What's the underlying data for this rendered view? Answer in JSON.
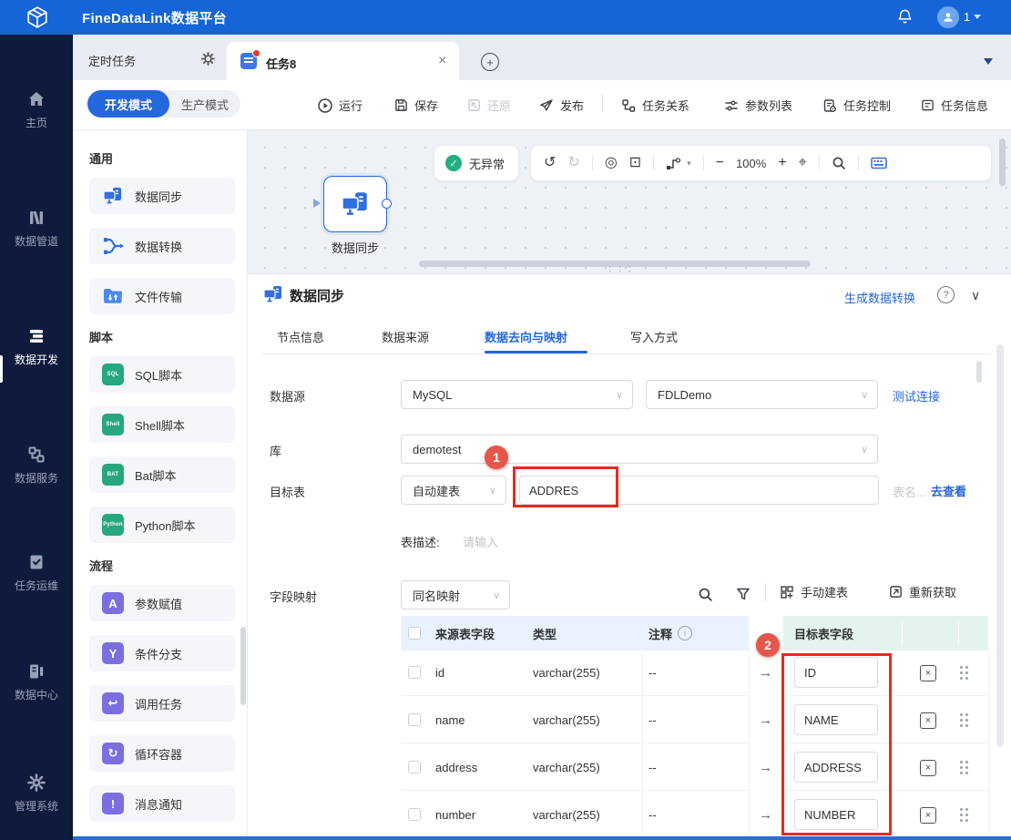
{
  "topbar": {
    "title": "FineDataLink数据平台",
    "user_badge": "1"
  },
  "tabstrip": {
    "panel_label": "定时任务",
    "tab_label": "任务8"
  },
  "toolbar": {
    "mode_dev": "开发模式",
    "mode_prod": "生产模式",
    "run": "运行",
    "save": "保存",
    "restore": "还原",
    "publish": "发布",
    "task_rel": "任务关系",
    "param_list": "参数列表",
    "task_ctrl": "任务控制",
    "task_info": "任务信息"
  },
  "sidebar": {
    "items": [
      {
        "label": "主页"
      },
      {
        "label": "数据管道"
      },
      {
        "label": "数据开发"
      },
      {
        "label": "数据服务"
      },
      {
        "label": "任务运维"
      },
      {
        "label": "数据中心"
      },
      {
        "label": "管理系统"
      }
    ],
    "active_index": 2
  },
  "palette": {
    "sec_general": "通用",
    "sec_script": "脚本",
    "sec_flow": "流程",
    "general": [
      {
        "label": "数据同步"
      },
      {
        "label": "数据转换"
      },
      {
        "label": "文件传输"
      }
    ],
    "script": [
      {
        "label": "SQL脚本",
        "icon_text": "SQL"
      },
      {
        "label": "Shell脚本",
        "icon_text": "Shell"
      },
      {
        "label": "Bat脚本",
        "icon_text": "BAT"
      },
      {
        "label": "Python脚本",
        "icon_text": "Python"
      }
    ],
    "flow": [
      {
        "label": "参数赋值",
        "glyph": "A"
      },
      {
        "label": "条件分支",
        "glyph": "Y"
      },
      {
        "label": "调用任务",
        "glyph": "↩"
      },
      {
        "label": "循环容器",
        "glyph": "↻"
      },
      {
        "label": "消息通知",
        "glyph": "!"
      }
    ]
  },
  "canvas": {
    "node_label": "数据同步",
    "status": "无异常",
    "zoom_level": "100%"
  },
  "panel": {
    "title": "数据同步",
    "gen_link": "生成数据转换",
    "tabs": [
      {
        "label": "节点信息"
      },
      {
        "label": "数据来源"
      },
      {
        "label": "数据去向与映射"
      },
      {
        "label": "写入方式"
      }
    ],
    "active_tab": 2
  },
  "form": {
    "datasource_label": "数据源",
    "datasource_type": "MySQL",
    "datasource_name": "FDLDemo",
    "test_link": "测试连接",
    "db_label": "库",
    "db_value": "demotest",
    "target_label": "目标表",
    "target_mode": "自动建表",
    "target_value": "ADDRES",
    "table_hint": "表名...",
    "view_link": "去查看",
    "desc_label": "表描述:",
    "desc_placeholder": "请输入",
    "mapping_label": "字段映射",
    "mapping_mode": "同名映射",
    "manual_create": "手动建表",
    "refetch": "重新获取"
  },
  "table": {
    "headers": {
      "source": "来源表字段",
      "type": "类型",
      "comment": "注释",
      "target": "目标表字段"
    },
    "rows": [
      {
        "source": "id",
        "type": "varchar(255)",
        "comment": "--",
        "target": "ID"
      },
      {
        "source": "name",
        "type": "varchar(255)",
        "comment": "--",
        "target": "NAME"
      },
      {
        "source": "address",
        "type": "varchar(255)",
        "comment": "--",
        "target": "ADDRESS"
      },
      {
        "source": "number",
        "type": "varchar(255)",
        "comment": "--",
        "target": "NUMBER"
      }
    ]
  },
  "annotations": {
    "badge1": "1",
    "badge2": "2"
  },
  "glyphs": {
    "check": "✓",
    "close_x": "×",
    "plus": "+",
    "minus": "−",
    "help": "?",
    "info": "i",
    "arrow_right": "→",
    "undo": "↺",
    "redo": "↻",
    "disc": "◎",
    "fit": "⊡",
    "crosshair": "⌖",
    "caret_down": "▾",
    "chevron": "∨",
    "dots_row": "· · ·"
  },
  "colors": {
    "topbar_blue": "#1565d8",
    "sidebar_navy": "#0e1b3c",
    "accent_blue": "#2567dd",
    "status_green": "#21b07e",
    "annotation_red": "#e32c1e",
    "source_header_bg": "#e8f1fc",
    "target_header_bg": "#e3f4ec",
    "script_icon_green": "#27a77d",
    "flow_icon_purple": "#7b6fe0"
  }
}
